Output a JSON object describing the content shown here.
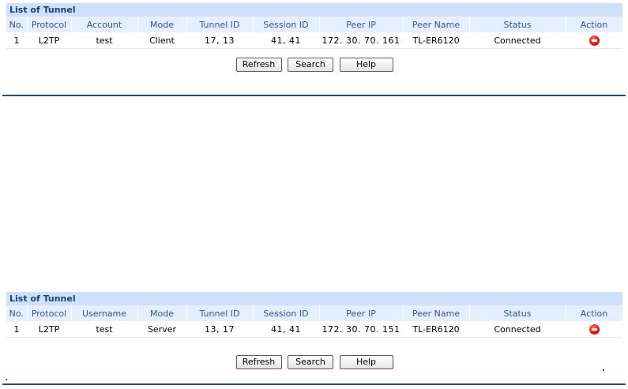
{
  "panels": [
    {
      "title": "List of Tunnel",
      "headers": [
        "No.",
        "Protocol",
        "Account",
        "Mode",
        "Tunnel ID",
        "Session ID",
        "Peer IP",
        "Peer Name",
        "Status",
        "Action"
      ],
      "row": {
        "no": "1",
        "protocol": "L2TP",
        "account": "test",
        "mode": "Client",
        "tunnel_id": "17, 13",
        "session_id": "41, 41",
        "peer_ip": "172. 30. 70. 161",
        "peer_name": "TL-ER6120",
        "status": "Connected",
        "action_icon": "delete-icon"
      },
      "buttons": {
        "refresh": "Refresh",
        "search": "Search",
        "help": "Help"
      }
    },
    {
      "title": "List of Tunnel",
      "headers": [
        "No.",
        "Protocol",
        "Username",
        "Mode",
        "Tunnel ID",
        "Session ID",
        "Peer IP",
        "Peer Name",
        "Status",
        "Action"
      ],
      "row": {
        "no": "1",
        "protocol": "L2TP",
        "account": "test",
        "mode": "Server",
        "tunnel_id": "13, 17",
        "session_id": "41, 41",
        "peer_ip": "172. 30. 70. 151",
        "peer_name": "TL-ER6120",
        "status": "Connected",
        "action_icon": "delete-icon"
      },
      "buttons": {
        "refresh": "Refresh",
        "search": "Search",
        "help": "Help"
      }
    }
  ],
  "colors": {
    "title_bg": "#cfe0fb",
    "header_bg": "#e6efff",
    "header_text": "#2f5590",
    "rule": "#1f4f7a",
    "action_red": "#e01b10"
  }
}
